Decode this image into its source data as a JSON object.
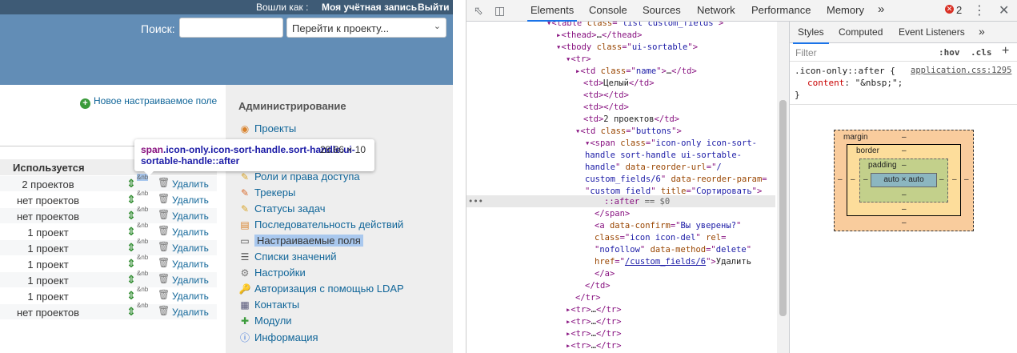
{
  "site": {
    "topbar": {
      "logged_as": "Вошли как :",
      "my_account": "Моя учётная запись",
      "logout": "Выйти"
    },
    "search": {
      "label": "Поиск:",
      "value": "",
      "jump_placeholder": "Перейти к проекту..."
    },
    "new_field_link": "Новое настраиваемое поле",
    "used_header": "Используется",
    "rows": [
      {
        "projects": "2 проектов",
        "nbsp": "&nb",
        "delete": "Удалить"
      },
      {
        "projects": "нет проектов",
        "nbsp": "&nb",
        "delete": "Удалить"
      },
      {
        "projects": "нет проектов",
        "nbsp": "&nb",
        "delete": "Удалить"
      },
      {
        "projects": "1 проект",
        "nbsp": "&nb",
        "delete": "Удалить"
      },
      {
        "projects": "1 проект",
        "nbsp": "&nb",
        "delete": "Удалить"
      },
      {
        "projects": "1 проект",
        "nbsp": "&nb",
        "delete": "Удалить"
      },
      {
        "projects": "1 проект",
        "nbsp": "&nb",
        "delete": "Удалить"
      },
      {
        "projects": "1 проект",
        "nbsp": "&nb",
        "delete": "Удалить"
      },
      {
        "projects": "нет проектов",
        "nbsp": "&nb",
        "delete": "Удалить"
      }
    ],
    "sidebar": {
      "title": "Администрирование",
      "items": [
        {
          "label": "Проекты",
          "icon": "projects-icon"
        },
        {
          "label": "Роли и права доступа",
          "icon": "roles-icon"
        },
        {
          "label": "Трекеры",
          "icon": "trackers-icon"
        },
        {
          "label": "Статусы задач",
          "icon": "issue-statuses-icon"
        },
        {
          "label": "Последовательность действий",
          "icon": "workflow-icon"
        },
        {
          "label": "Настраиваемые поля",
          "icon": "custom-fields-icon"
        },
        {
          "label": "Списки значений",
          "icon": "enumerations-icon"
        },
        {
          "label": "Настройки",
          "icon": "settings-icon"
        },
        {
          "label": "Авторизация с помощью LDAP",
          "icon": "ldap-icon"
        },
        {
          "label": "Контакты",
          "icon": "contacts-icon"
        },
        {
          "label": "Модули",
          "icon": "plugins-icon"
        },
        {
          "label": "Информация",
          "icon": "info-icon"
        }
      ]
    },
    "tooltip": {
      "tag": "span",
      "classes": ".icon-only.icon-sort-handle.sort-handle.ui-sortable-handle::after",
      "size": "28.66 × 10"
    }
  },
  "devtools": {
    "tabs": [
      "Elements",
      "Console",
      "Sources",
      "Network",
      "Performance",
      "Memory",
      "»"
    ],
    "active_tab": "Elements",
    "error_count": "2",
    "styles_tabs": [
      "Styles",
      "Computed",
      "Event Listeners",
      "»"
    ],
    "filter_placeholder": "Filter",
    "hov": ":hov",
    "cls": ".cls",
    "rule": {
      "selector": ".icon-only::after {",
      "source": "application.css:1295",
      "property": "content",
      "value": "\"&nbsp;\";",
      "close": "}"
    },
    "boxmodel": {
      "margin": "margin",
      "border": "border",
      "padding": "padding",
      "content": "auto × auto",
      "dash": "–"
    }
  },
  "colors": {
    "header": "#628db6",
    "topbar": "#3e5b76",
    "link": "#116699",
    "sidebar_bg": "#eeeeee",
    "selected": "#a9c8ee"
  }
}
